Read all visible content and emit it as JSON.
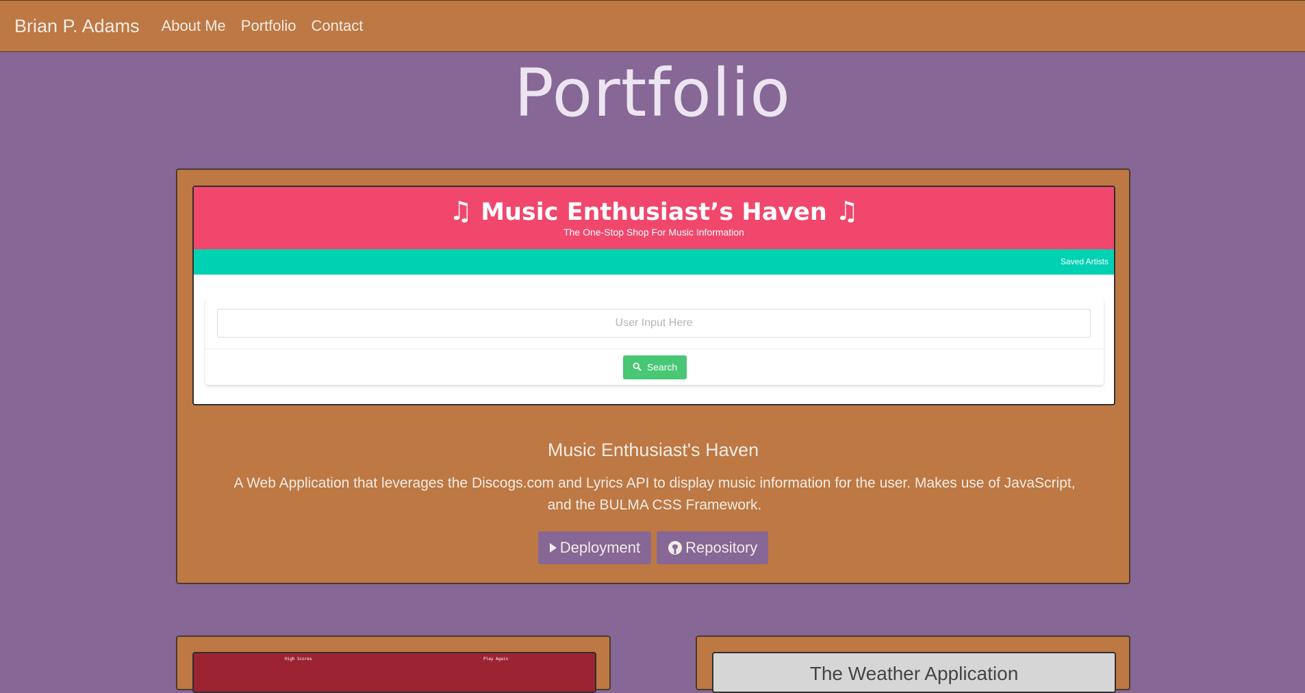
{
  "nav": {
    "brand": "Brian P. Adams",
    "links": [
      "About Me",
      "Portfolio",
      "Contact"
    ]
  },
  "page_title": "Portfolio",
  "featured_project": {
    "screenshot": {
      "title": "Music Enthusiast’s Haven",
      "subtitle": "The One-Stop Shop For Music Information",
      "nav_link": "Saved Artists",
      "input_placeholder": "User Input Here",
      "search_label": "Search"
    },
    "title": "Music Enthusiast's Haven",
    "description": "A Web Application that leverages the Discogs.com and Lyrics API to display music information for the user. Makes use of JavaScript, and the BULMA CSS Framework.",
    "deployment_label": "Deployment",
    "repository_label": "Repository"
  },
  "project_2": {
    "screenshot": {
      "link_left": "High Scores",
      "link_right": "Play Again"
    }
  },
  "project_3": {
    "screenshot": {
      "title": "The Weather Application"
    }
  },
  "colors": {
    "background": "#866796",
    "card": "#bd7843",
    "hero": "#f1476c",
    "teal": "#00d1b2",
    "search_button": "#48c774"
  },
  "icons": [
    "music-note-icon",
    "search-icon",
    "play-icon",
    "github-icon"
  ]
}
